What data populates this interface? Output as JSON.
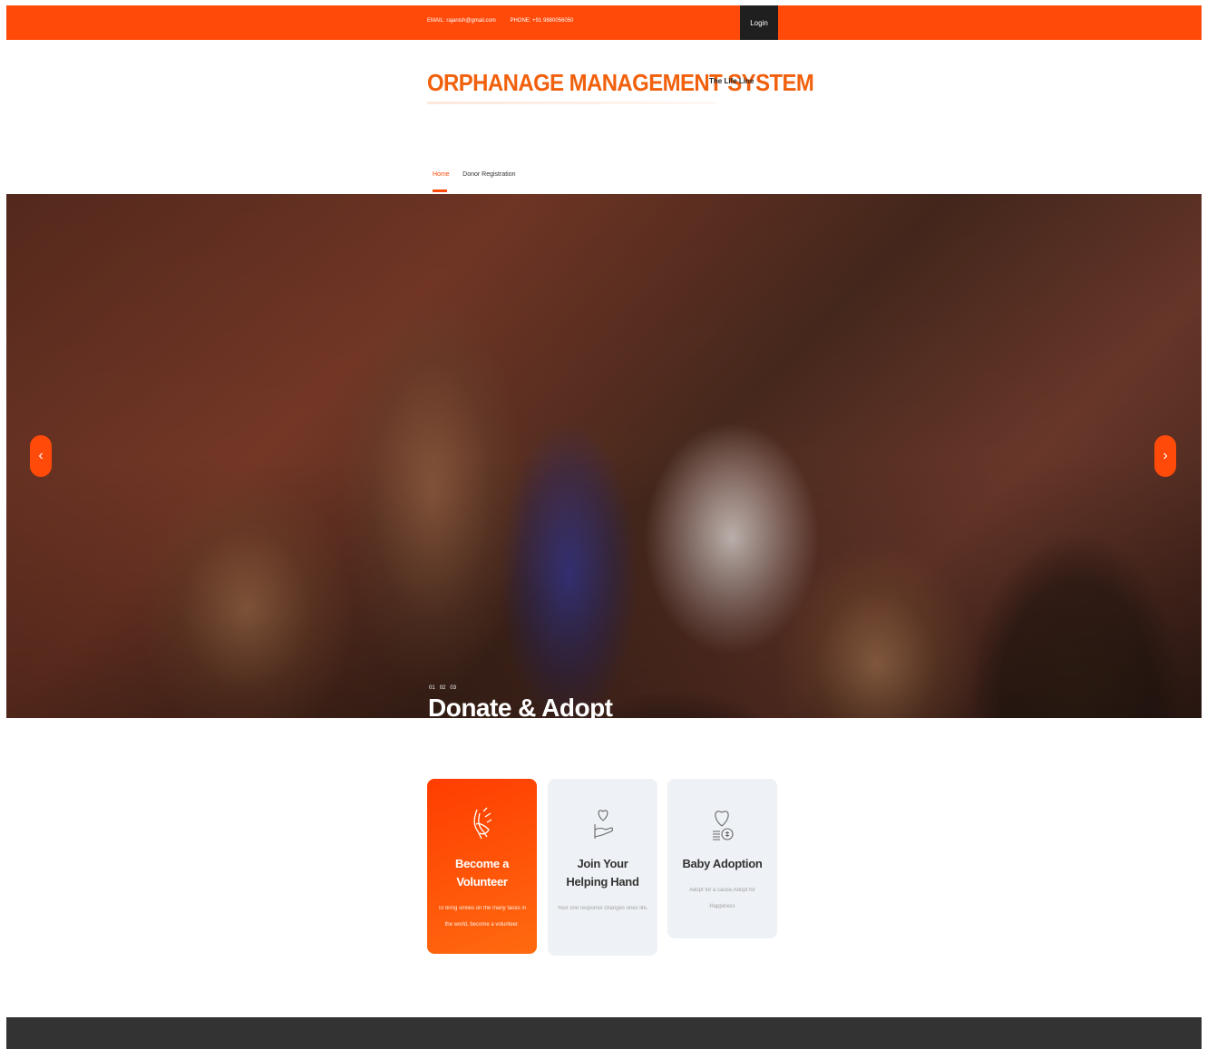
{
  "topbar": {
    "email": "EMAIL: rajanish@gmail.com",
    "phone": "PHONE: +91 9880056050",
    "login_label": "Login"
  },
  "brand": {
    "title": "ORPHANAGE MANAGEMENT SYSTEM",
    "tagline": "The Life Line"
  },
  "nav": {
    "items": [
      {
        "label": "Home",
        "active": true
      },
      {
        "label": "Donor Registration",
        "active": false
      }
    ]
  },
  "hero": {
    "caption": "Donate & Adopt",
    "indicators": [
      "01",
      "02",
      "03"
    ],
    "prev_icon": "chevron-left-icon",
    "next_icon": "chevron-right-icon"
  },
  "cards": [
    {
      "icon": "hands-icon",
      "title": "Become a Volunteer",
      "text": "To bring smiles on the many faces in the world, become a volunteer."
    },
    {
      "icon": "heart-hand-icon",
      "title": "Join Your Helping Hand",
      "text": "Your one response changes ones life."
    },
    {
      "icon": "heart-coin-icon",
      "title": "Baby Adoption",
      "text": "Adopt for a cause,Adopt for Happiness"
    }
  ],
  "colors": {
    "accent": "#ff4a0a",
    "brand_text": "#f1600c",
    "dark": "#1f1f1f",
    "card_bg": "#eef1f5",
    "footer": "#333333"
  }
}
